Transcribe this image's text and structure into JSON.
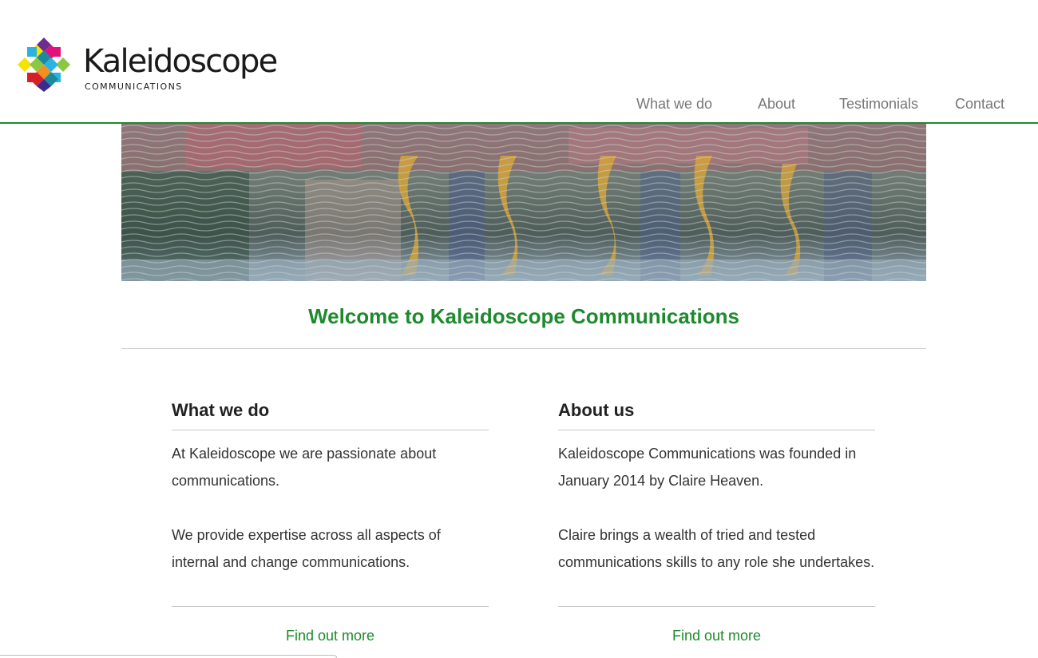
{
  "brand": {
    "name": "Kaleidoscope",
    "tagline": "COMMUNICATIONS",
    "logo_icon": "kaleidoscope-diamond-logo-icon",
    "colors": [
      "#e2127a",
      "#f4e400",
      "#2bb2e4",
      "#8dc63f",
      "#d61f26",
      "#3a2b8f",
      "#1a8a9e",
      "#f28f1f"
    ]
  },
  "nav": {
    "items": [
      {
        "label": "What we do"
      },
      {
        "label": "About"
      },
      {
        "label": "Testimonials"
      },
      {
        "label": "Contact"
      }
    ]
  },
  "main": {
    "title": "Welcome to Kaleidoscope Communications",
    "hero_image": "rippled-water-reflection-photo"
  },
  "sections": [
    {
      "heading": "What we do",
      "paragraphs": [
        "At Kaleidoscope we are passionate about communications.",
        "We provide expertise across all aspects of internal and change communications."
      ],
      "link": "Find out more"
    },
    {
      "heading": "About us",
      "paragraphs": [
        "Kaleidoscope Communications was founded in January 2014 by Claire Heaven.",
        "Claire brings a wealth of tried and tested communications skills to any role she undertakes."
      ],
      "link": "Find out more"
    }
  ],
  "theme": {
    "accent": "#1e8a2e",
    "rule": "#c9c9c9",
    "nav_text": "#777777"
  }
}
